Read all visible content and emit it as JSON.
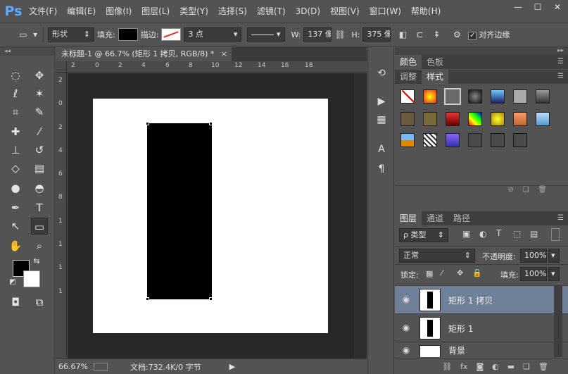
{
  "app": {
    "logo": "Ps"
  },
  "menu": [
    "文件(F)",
    "编辑(E)",
    "图像(I)",
    "图层(L)",
    "类型(Y)",
    "选择(S)",
    "滤镜(T)",
    "3D(D)",
    "视图(V)",
    "窗口(W)",
    "帮助(H)"
  ],
  "window_controls": {
    "minimize": "—",
    "restore": "☐",
    "close": "✕"
  },
  "options": {
    "mode": "形状",
    "fill_label": "填充:",
    "stroke_label": "描边:",
    "stroke_width": "3 点",
    "w_label": "W:",
    "w_value": "137 像",
    "h_label": "H:",
    "h_value": "375 像",
    "align_edges": "对齐边缘"
  },
  "document": {
    "tab_title": "未标题-1 @ 66.7% (矩形 1 拷贝, RGB/8) *",
    "ruler_h": [
      "2",
      "0",
      "2",
      "4",
      "6",
      "8",
      "10",
      "12",
      "14",
      "16",
      "18"
    ],
    "ruler_v": [
      "2",
      "0",
      "2",
      "4",
      "6",
      "8",
      "1",
      "1",
      "1",
      "1"
    ]
  },
  "status": {
    "zoom": "66.67%",
    "doc_info": "文档:732.4K/0 字节"
  },
  "panels": {
    "color_tabs": [
      "颜色",
      "色板"
    ],
    "style_tabs": [
      "调整",
      "样式"
    ],
    "layer_tabs": [
      "图层",
      "通道",
      "路径"
    ],
    "filter_kind": "ρ 类型",
    "blend_mode": "正常",
    "opacity_label": "不透明度:",
    "opacity_value": "100%",
    "lock_label": "锁定:",
    "fill_label": "填充:",
    "fill_value": "100%"
  },
  "layers": [
    {
      "name": "矩形 1 拷贝",
      "selected": true
    },
    {
      "name": "矩形 1",
      "selected": false
    },
    {
      "name": "背景",
      "selected": false
    }
  ],
  "colors": {
    "selected_layer": "#6f8098",
    "canvas_bg": "#282828"
  }
}
